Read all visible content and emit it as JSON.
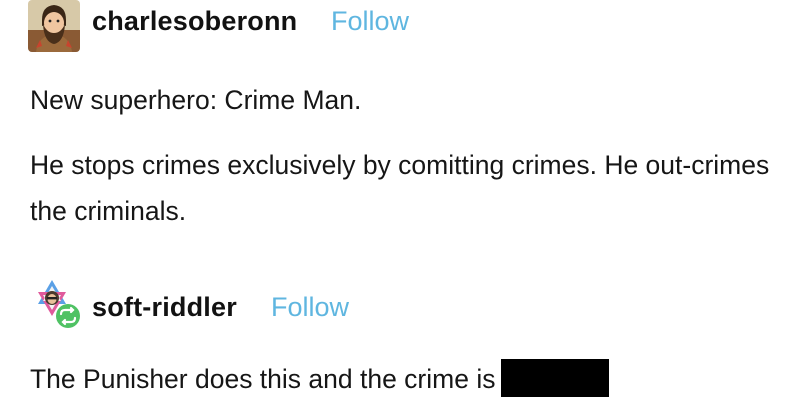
{
  "posts": [
    {
      "username": "charlesoberonn",
      "follow_label": "Follow",
      "paragraphs": [
        "New superhero: Crime Man.",
        "He stops crimes exclusively by comitting crimes. He out-crimes the criminals."
      ]
    },
    {
      "username": "soft-riddler",
      "follow_label": "Follow",
      "is_reblog": true,
      "paragraphs": [
        "The Punisher does this and the crime is"
      ],
      "has_redaction": true
    }
  ],
  "colors": {
    "follow_link": "#5fb6e0",
    "reblog_badge": "#4fc264",
    "redaction": "#000000"
  }
}
